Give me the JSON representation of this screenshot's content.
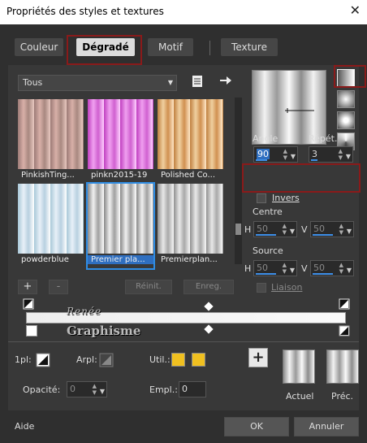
{
  "window": {
    "title": "Propriétés des styles et textures",
    "close_icon": "close-icon"
  },
  "tabs": [
    {
      "label": "Couleur",
      "active": false
    },
    {
      "label": "Dégradé",
      "active": true
    },
    {
      "label": "Motif",
      "active": false
    },
    {
      "label": "Texture",
      "active": false
    }
  ],
  "library": {
    "category": "Tous",
    "items": [
      {
        "label": "PinkishTing...",
        "colors": [
          "#9c7a76",
          "#d8b0a8",
          "#a88880",
          "#e8c8c0"
        ]
      },
      {
        "label": "pinkn2015-19",
        "colors": [
          "#c040c0",
          "#f0a0f0",
          "#d060d0",
          "#ffd0ff"
        ]
      },
      {
        "label": "Polished Co...",
        "colors": [
          "#c08040",
          "#f0d0a0",
          "#d09050",
          "#ffe8c8"
        ]
      },
      {
        "label": "powderblue",
        "colors": [
          "#a8c8d8",
          "#e8f0f8",
          "#b8d0e0",
          "#ffffff"
        ]
      },
      {
        "label": "Premier pla...",
        "colors": [
          "#888888",
          "#f0f0f0",
          "#a0a0a0",
          "#ffffff"
        ],
        "selected": true
      },
      {
        "label": "Premierplan...",
        "colors": [
          "#909090",
          "#e8e8e8",
          "#a8a8a8",
          "#f8f8f8"
        ]
      }
    ],
    "add_label": "+",
    "remove_label": "-",
    "reset_label": "Réinit.",
    "save_label": "Enreg."
  },
  "params": {
    "angle_label": "Angle",
    "angle_value": "90",
    "repeat_label": "Répét.",
    "repeat_value": "3",
    "invert_label": "Invers",
    "center_label": "Centre",
    "center_h_label": "H",
    "center_h": "50",
    "center_v_label": "V",
    "center_v": "50",
    "source_label": "Source",
    "source_h_label": "H",
    "source_h": "50",
    "source_v_label": "V",
    "source_v": "50",
    "link_label": "Liaison"
  },
  "editor": {
    "fg_label": "1pl:",
    "bg_label": "Arpl:",
    "user_label": "Util.:",
    "opacity_label": "Opacité:",
    "opacity_value": "0",
    "position_label": "Empl.:",
    "position_value": "0",
    "user_color": "#f0c020"
  },
  "previews": {
    "add_label": "+",
    "current_label": "Actuel",
    "previous_label": "Préc."
  },
  "watermark": {
    "line1": "Renée",
    "line2": "Graphisme"
  },
  "footer": {
    "help_label": "Aide",
    "ok_label": "OK",
    "cancel_label": "Annuler"
  },
  "colors": {
    "accent": "#2f8de4",
    "highlight_box": "#8a1a1a"
  }
}
